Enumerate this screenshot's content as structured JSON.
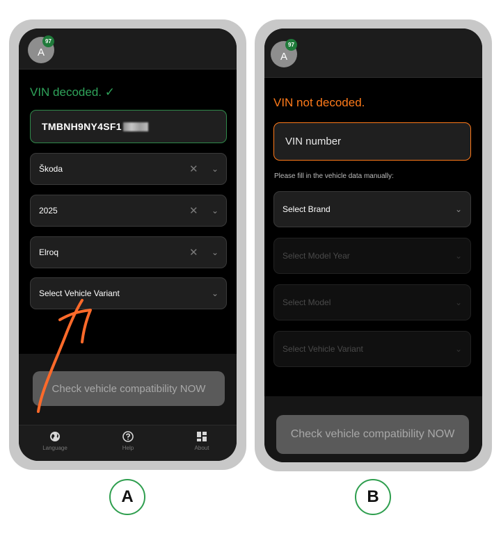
{
  "panel_a": {
    "avatar_letter": "A",
    "badge_count": "97",
    "status": "VIN decoded. ✓",
    "vin_value": "TMBNH9NY4SF1",
    "fields": [
      {
        "value": "Škoda",
        "clearable": true
      },
      {
        "value": "2025",
        "clearable": true
      },
      {
        "value": "Elroq",
        "clearable": true
      },
      {
        "value": "Select Vehicle Variant",
        "clearable": false
      }
    ],
    "check_button": "Check vehicle compatibility NOW",
    "nav": [
      {
        "icon": "globe-icon",
        "label": "Language"
      },
      {
        "icon": "help-icon",
        "label": "Help"
      },
      {
        "icon": "grid-icon",
        "label": "About"
      }
    ],
    "label": "A"
  },
  "panel_b": {
    "avatar_letter": "A",
    "badge_count": "97",
    "status": "VIN not decoded.",
    "vin_placeholder": "VIN number",
    "hint": "Please fill in the vehicle data manually:",
    "fields": [
      {
        "value": "Select Brand",
        "disabled": false
      },
      {
        "value": "Select Model Year",
        "disabled": true
      },
      {
        "value": "Select Model",
        "disabled": true
      },
      {
        "value": "Select Vehicle Variant",
        "disabled": true
      }
    ],
    "check_button": "Check vehicle compatibility NOW",
    "label": "B"
  },
  "colors": {
    "success": "#2fa35a",
    "error": "#ff7a1a",
    "annotation_arrow": "#ff6a2a",
    "label_ring": "#2e9e4e"
  }
}
